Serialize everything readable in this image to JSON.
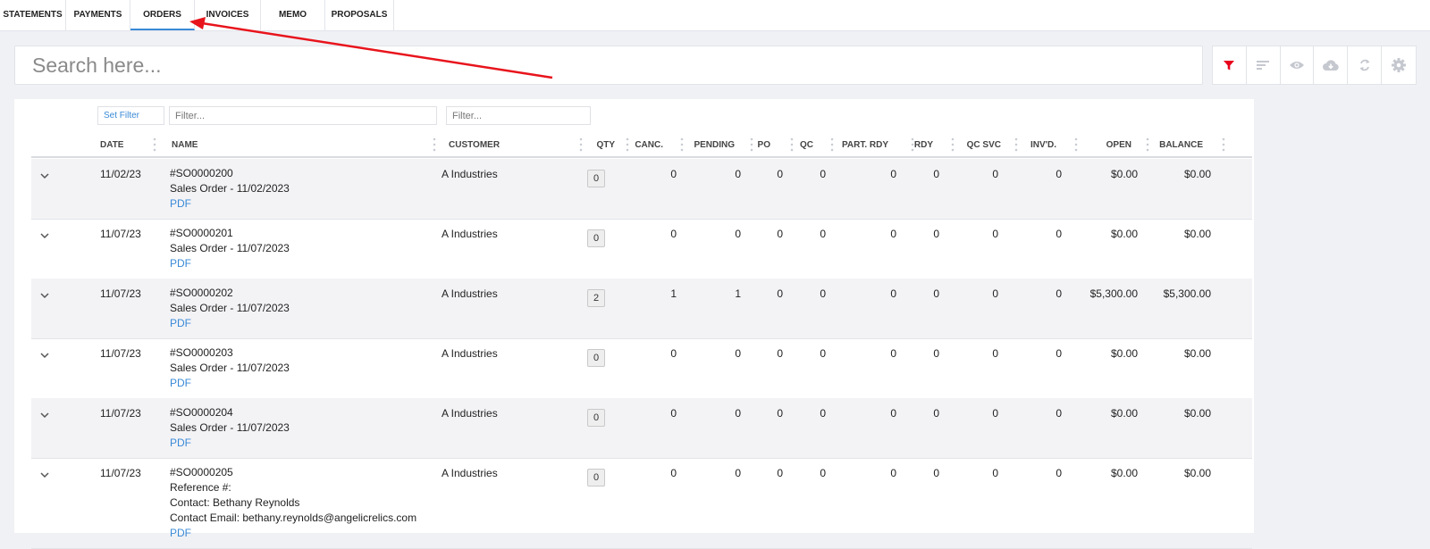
{
  "tabs": [
    "STATEMENTS",
    "PAYMENTS",
    "ORDERS",
    "INVOICES",
    "MEMO",
    "PROPOSALS"
  ],
  "active_tab": "ORDERS",
  "search": {
    "placeholder": "Search here..."
  },
  "toolbar": {
    "icons": [
      "filter-icon",
      "sort-icon",
      "eye-icon",
      "cloud-download-icon",
      "refresh-icon",
      "gear-icon"
    ],
    "active_color": "#e8001c",
    "icon_color": "#c5c8cf"
  },
  "filters": {
    "set_filter_label": "Set Filter",
    "name_placeholder": "Filter...",
    "customer_placeholder": "Filter..."
  },
  "columns": {
    "date": "DATE",
    "name": "NAME",
    "customer": "CUSTOMER",
    "qty": "QTY",
    "canc": "CANC.",
    "pending": "PENDING",
    "po": "PO",
    "qc": "QC",
    "part_rdy": "PART. RDY",
    "rdy": "RDY",
    "qc_svc": "QC SVC",
    "invd": "INV'D.",
    "open": "OPEN",
    "balance": "BALANCE"
  },
  "rows": [
    {
      "date": "11/02/23",
      "name_lines": [
        "#SO0000200",
        "Sales Order - 11/02/2023"
      ],
      "pdf": "PDF",
      "customer": "A Industries",
      "qty": "0",
      "canc": "0",
      "pending": "0",
      "po": "0",
      "qc": "0",
      "part_rdy": "0",
      "rdy": "0",
      "qc_svc": "0",
      "invd": "0",
      "open": "$0.00",
      "balance": "$0.00"
    },
    {
      "date": "11/07/23",
      "name_lines": [
        "#SO0000201",
        "Sales Order - 11/07/2023"
      ],
      "pdf": "PDF",
      "customer": "A Industries",
      "qty": "0",
      "canc": "0",
      "pending": "0",
      "po": "0",
      "qc": "0",
      "part_rdy": "0",
      "rdy": "0",
      "qc_svc": "0",
      "invd": "0",
      "open": "$0.00",
      "balance": "$0.00"
    },
    {
      "date": "11/07/23",
      "name_lines": [
        "#SO0000202",
        "Sales Order - 11/07/2023"
      ],
      "pdf": "PDF",
      "customer": "A Industries",
      "qty": "2",
      "canc": "1",
      "pending": "1",
      "po": "0",
      "qc": "0",
      "part_rdy": "0",
      "rdy": "0",
      "qc_svc": "0",
      "invd": "0",
      "open": "$5,300.00",
      "balance": "$5,300.00"
    },
    {
      "date": "11/07/23",
      "name_lines": [
        "#SO0000203",
        "Sales Order - 11/07/2023"
      ],
      "pdf": "PDF",
      "customer": "A Industries",
      "qty": "0",
      "canc": "0",
      "pending": "0",
      "po": "0",
      "qc": "0",
      "part_rdy": "0",
      "rdy": "0",
      "qc_svc": "0",
      "invd": "0",
      "open": "$0.00",
      "balance": "$0.00"
    },
    {
      "date": "11/07/23",
      "name_lines": [
        "#SO0000204",
        "Sales Order - 11/07/2023"
      ],
      "pdf": "PDF",
      "customer": "A Industries",
      "qty": "0",
      "canc": "0",
      "pending": "0",
      "po": "0",
      "qc": "0",
      "part_rdy": "0",
      "rdy": "0",
      "qc_svc": "0",
      "invd": "0",
      "open": "$0.00",
      "balance": "$0.00"
    },
    {
      "date": "11/07/23",
      "name_lines": [
        "#SO0000205",
        "Reference #:",
        "Contact: Bethany Reynolds",
        "Contact Email: bethany.reynolds@angelicrelics.com"
      ],
      "pdf": "PDF",
      "customer": "A Industries",
      "qty": "0",
      "canc": "0",
      "pending": "0",
      "po": "0",
      "qc": "0",
      "part_rdy": "0",
      "rdy": "0",
      "qc_svc": "0",
      "invd": "0",
      "open": "$0.00",
      "balance": "$0.00"
    }
  ],
  "annotation": {
    "arrow_color": "#e8141c"
  }
}
